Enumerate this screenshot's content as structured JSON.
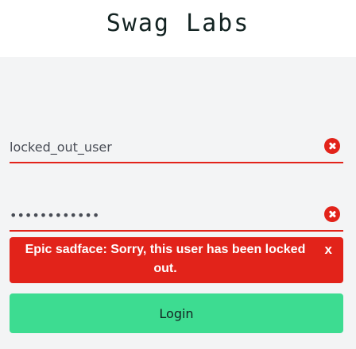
{
  "header": {
    "logo_text": "Swag Labs"
  },
  "login": {
    "username": {
      "value": "locked_out_user",
      "error_icon": "circle-x-icon"
    },
    "password": {
      "value": "••••••••••••",
      "error_icon": "circle-x-icon"
    },
    "error": {
      "message": "Epic sadface: Sorry, this user has been locked out.",
      "close_label": "x",
      "color": "#e2231a"
    },
    "submit_label": "Login",
    "submit_color": "#3ddc91"
  }
}
